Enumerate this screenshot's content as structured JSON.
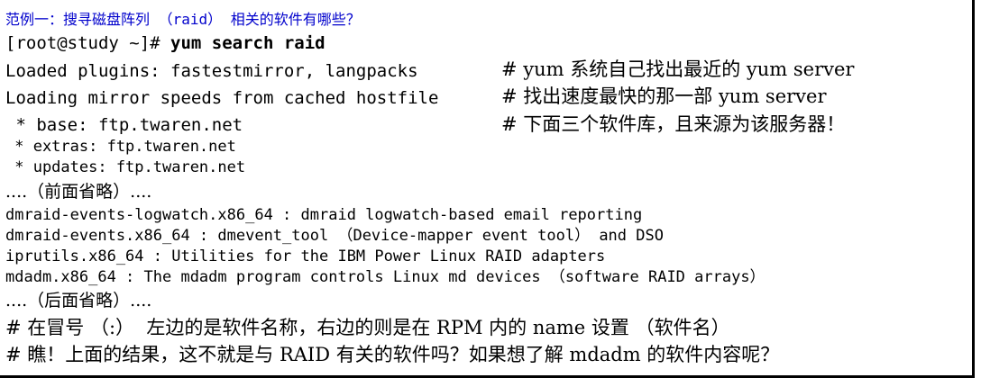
{
  "title": "范例一：搜寻磁盘阵列 （raid） 相关的软件有哪些？",
  "prompt": "[root@study ~]# ",
  "command": "yum search raid",
  "lines": [
    {
      "text": "Loaded plugins: fastestmirror, langpacks",
      "comment": "# yum 系统自己找出最近的 yum server"
    },
    {
      "text": "Loading mirror speeds from cached hostfile",
      "comment": "# 找出速度最快的那一部 yum server"
    },
    {
      "text": " * base: ftp.twaren.net",
      "comment": "# 下面三个软件库，且来源为该服务器！"
    },
    {
      "text": " * extras: ftp.twaren.net",
      "comment": ""
    },
    {
      "text": " * updates: ftp.twaren.net",
      "comment": ""
    },
    {
      "text": "....（前面省略）....",
      "comment": ""
    },
    {
      "text": "dmraid-events-logwatch.x86_64 : dmraid logwatch-based email reporting",
      "comment": ""
    },
    {
      "text": "dmraid-events.x86_64 : dmevent_tool （Device-mapper event tool） and DSO",
      "comment": ""
    },
    {
      "text": "iprutils.x86_64 : Utilities for the IBM Power Linux RAID adapters",
      "comment": ""
    },
    {
      "text": "mdadm.x86_64 : The mdadm program controls Linux md devices （software RAID arrays）",
      "comment": ""
    },
    {
      "text": "....（后面省略）....",
      "comment": ""
    }
  ],
  "notes": [
    "# 在冒号 （:）  左边的是软件名称，右边的则是在 RPM 内的 name 设置 （软件名）",
    "# 瞧！上面的结果，这不就是与 RAID 有关的软件吗？如果想了解 mdadm 的软件内容呢？"
  ]
}
